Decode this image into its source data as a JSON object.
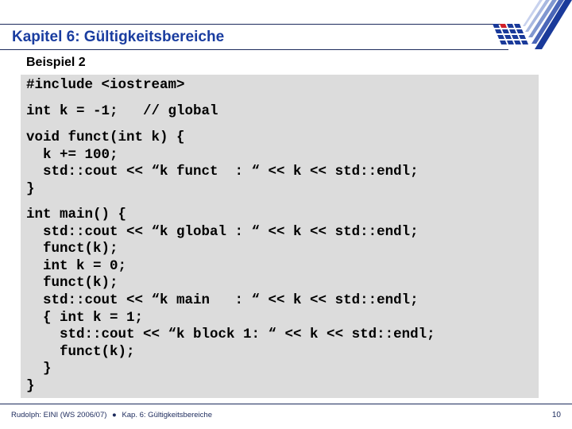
{
  "header": {
    "title": "Kapitel 6: Gültigkeitsbereiche",
    "logo": "university-logo-icon"
  },
  "slide": {
    "subtitle": "Beispiel 2",
    "code_blocks": [
      "#include <iostream>",
      "int k = -1;   // global",
      "void funct(int k) {\n  k += 100;\n  std::cout << “k funct  : “ << k << std::endl;\n}",
      "int main() {\n  std::cout << “k global : “ << k << std::endl;\n  funct(k);\n  int k = 0;\n  funct(k);\n  std::cout << “k main   : “ << k << std::endl;\n  { int k = 1;\n    std::cout << “k block 1: “ << k << std::endl;\n    funct(k);\n  }\n}"
    ]
  },
  "footer": {
    "source": "Rudolph: EINI (WS 2006/07)",
    "bullet": "●",
    "chapter": "Kap. 6: Gültigkeitsbereiche",
    "page_number": "10"
  },
  "colors": {
    "title": "#1a3da0",
    "rule": "#1c2a5c",
    "code_background": "#dcdcdc",
    "logo_accent": "#d0202a"
  }
}
